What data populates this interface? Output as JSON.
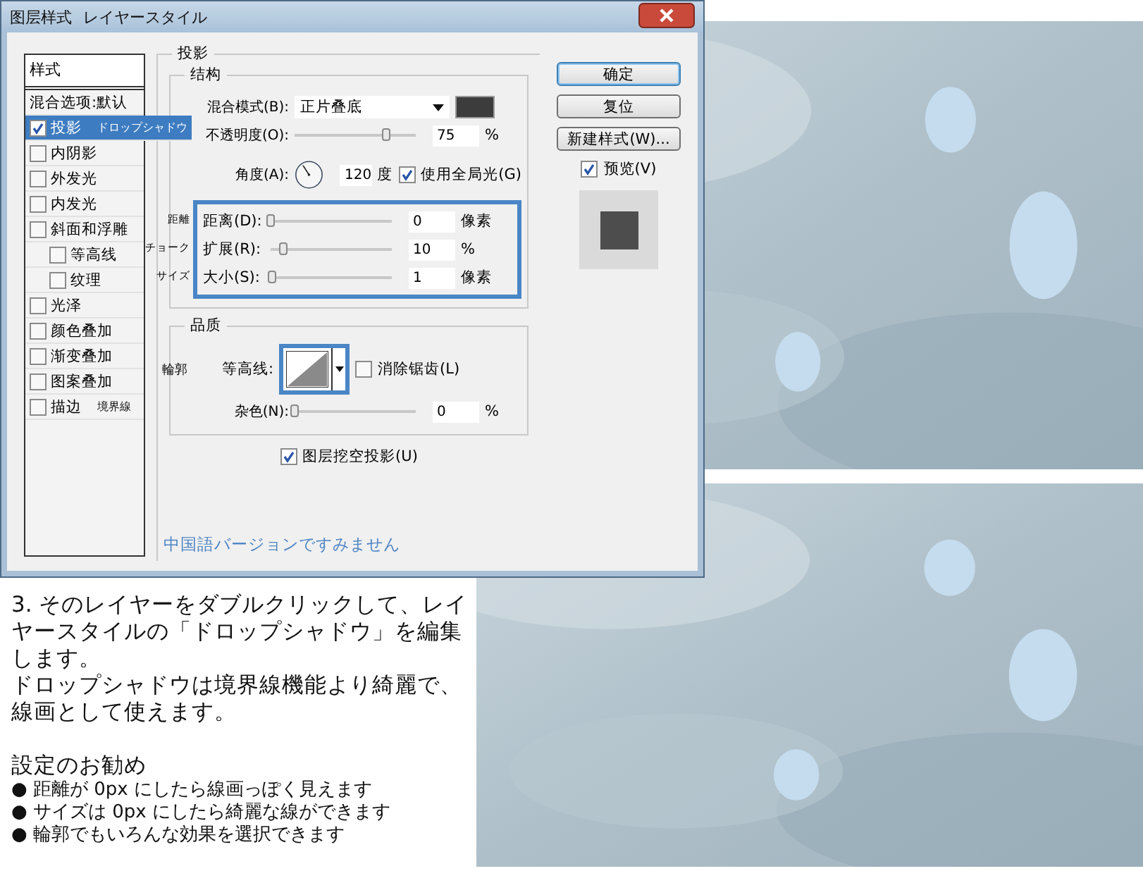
{
  "dialog": {
    "title": "图层样式",
    "title_note": "レイヤースタイル",
    "styles": {
      "header": "样式",
      "items": [
        {
          "kind": "plain",
          "label": "混合选项:默认",
          "selected": false
        },
        {
          "kind": "check",
          "label": "投影",
          "note": "ドロップシャドウ",
          "checked": true,
          "selected": true
        },
        {
          "kind": "check",
          "label": "内阴影",
          "checked": false,
          "selected": false
        },
        {
          "kind": "check",
          "label": "外发光",
          "checked": false,
          "selected": false
        },
        {
          "kind": "check",
          "label": "内发光",
          "checked": false,
          "selected": false
        },
        {
          "kind": "check",
          "label": "斜面和浮雕",
          "checked": false,
          "selected": false,
          "children": [
            {
              "kind": "check",
              "label": "等高线",
              "checked": false,
              "selected": false
            },
            {
              "kind": "check",
              "label": "纹理",
              "checked": false,
              "selected": false
            }
          ]
        },
        {
          "kind": "check",
          "label": "光泽",
          "checked": false,
          "selected": false
        },
        {
          "kind": "check",
          "label": "颜色叠加",
          "checked": false,
          "selected": false
        },
        {
          "kind": "check",
          "label": "渐变叠加",
          "checked": false,
          "selected": false
        },
        {
          "kind": "check",
          "label": "图案叠加",
          "checked": false,
          "selected": false
        },
        {
          "kind": "check",
          "label": "描边",
          "note": "境界線",
          "checked": false,
          "selected": false
        }
      ]
    },
    "section": "投影",
    "structure": {
      "title": "结构",
      "blend_mode": {
        "label": "混合模式(B):",
        "value": "正片叠底"
      },
      "opacity": {
        "label": "不透明度(O):",
        "level": 0.75,
        "value": "75",
        "unit": "%"
      },
      "angle": {
        "label": "角度(A):",
        "value": "120",
        "unit": "度",
        "global_light": {
          "label": "使用全局光(G)",
          "checked": true
        }
      },
      "highlighted": [
        {
          "note": "距離",
          "label": "距离(D):",
          "level": 0,
          "value": "0",
          "unit": "像素"
        },
        {
          "note": "チョーク",
          "label": "扩展(R):",
          "level": 0.1,
          "value": "10",
          "unit": "%"
        },
        {
          "note": "サイズ",
          "label": "大小(S):",
          "level": 0.01,
          "value": "1",
          "unit": "像素"
        }
      ]
    },
    "quality": {
      "title": "品质",
      "contour": {
        "note": "輪郭",
        "label": "等高线:"
      },
      "anti_alias": {
        "label": "消除锯齿(L)",
        "checked": false
      },
      "noise": {
        "label": "杂色(N):",
        "level": 0,
        "value": "0",
        "unit": "%"
      }
    },
    "knockout": {
      "label": "图层挖空投影(U)",
      "checked": true
    },
    "footer_note": "中国語バージョンですみません",
    "buttons": [
      {
        "label": "确定",
        "default": true
      },
      {
        "label": "复位",
        "default": false
      },
      {
        "label": "新建样式(W)...",
        "default": false
      }
    ],
    "preview": {
      "label": "预览(V)",
      "checked": true
    }
  },
  "article": {
    "paragraphs": [
      "3. そのレイヤーをダブルクリックして、レイヤースタイルの「ドロップシャドウ」を編集します。",
      "ドロップシャドウは境界線機能より綺麗で、線画として使えます。"
    ],
    "heading": "設定のお勧め",
    "bullets": [
      "● 距離が 0px にしたら線画っぽく見えます",
      "● サイズは 0px にしたら綺麗な線ができます",
      "● 輪郭でもいろんな効果を選択できます"
    ]
  }
}
